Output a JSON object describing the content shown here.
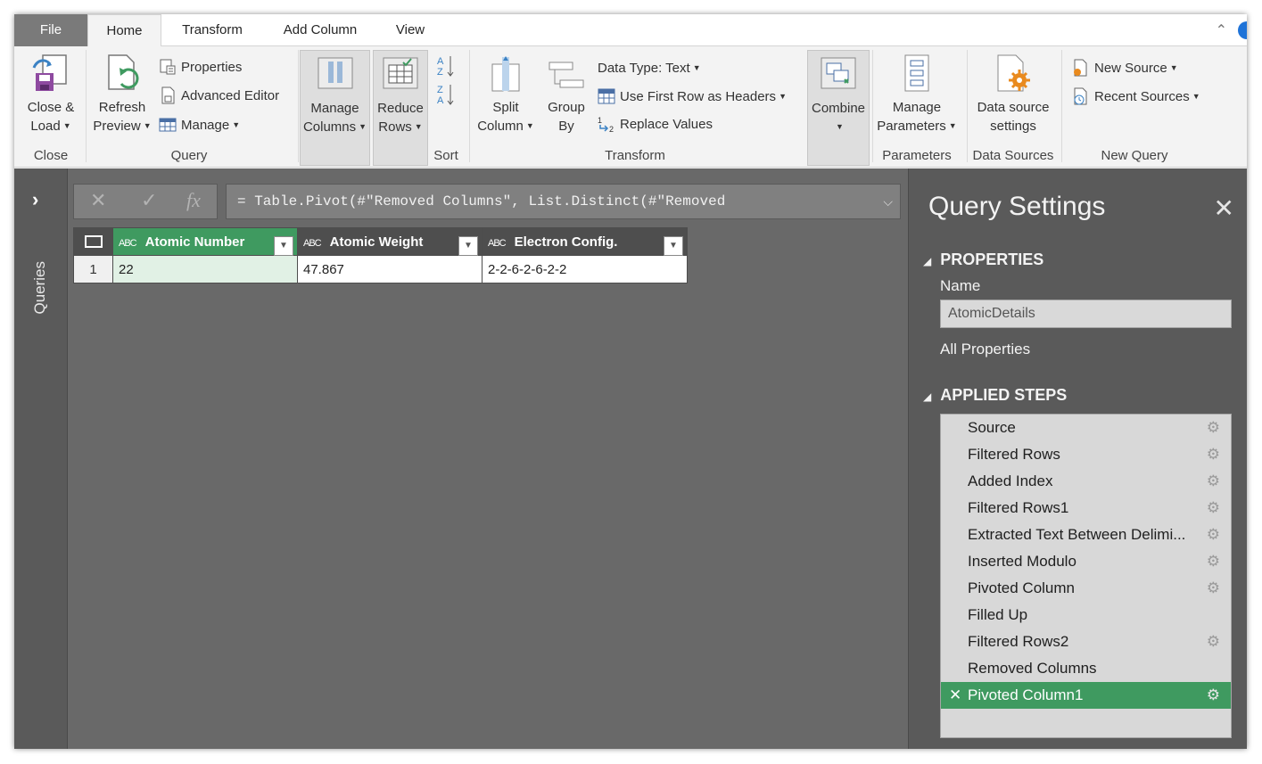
{
  "tabs": [
    "File",
    "Home",
    "Transform",
    "Add Column",
    "View"
  ],
  "ribbon": {
    "close": {
      "button": "Close &",
      "button2": "Load",
      "label": "Close"
    },
    "query": {
      "refresh": "Refresh",
      "refresh2": "Preview",
      "properties": "Properties",
      "advanced_editor": "Advanced Editor",
      "manage": "Manage",
      "label": "Query"
    },
    "manage_columns": {
      "line1": "Manage",
      "line2": "Columns"
    },
    "reduce_rows": {
      "line1": "Reduce",
      "line2": "Rows"
    },
    "sort": {
      "label": "Sort"
    },
    "transform": {
      "split": "Split",
      "split2": "Column",
      "group": "Group",
      "group2": "By",
      "data_type": "Data Type: Text",
      "first_row": "Use First Row as Headers",
      "replace": "Replace Values",
      "label": "Transform"
    },
    "combine": {
      "line1": "Combine"
    },
    "parameters": {
      "line1": "Manage",
      "line2": "Parameters",
      "label": "Parameters"
    },
    "data_sources": {
      "line1": "Data source",
      "line2": "settings",
      "label": "Data Sources"
    },
    "new_query": {
      "new_source": "New Source",
      "recent_sources": "Recent Sources",
      "label": "New Query"
    }
  },
  "queries_pane": {
    "label": "Queries"
  },
  "formula_bar": {
    "text": "= Table.Pivot(#\"Removed Columns\", List.Distinct(#\"Removed"
  },
  "grid": {
    "type_prefix": "ABC",
    "columns": [
      "Atomic Number",
      "Atomic Weight",
      "Electron Config."
    ],
    "rows": [
      {
        "num": "1",
        "cells": [
          "22",
          "47.867",
          "2-2-6-2-6-2-2"
        ]
      }
    ]
  },
  "settings": {
    "title": "Query Settings",
    "properties_head": "PROPERTIES",
    "name_label": "Name",
    "name_value": "AtomicDetails",
    "all_properties": "All Properties",
    "steps_head": "APPLIED STEPS",
    "steps": [
      {
        "name": "Source",
        "gear": true
      },
      {
        "name": "Filtered Rows",
        "gear": true
      },
      {
        "name": "Added Index",
        "gear": true
      },
      {
        "name": "Filtered Rows1",
        "gear": true
      },
      {
        "name": "Extracted Text Between Delimi...",
        "gear": true
      },
      {
        "name": "Inserted Modulo",
        "gear": true
      },
      {
        "name": "Pivoted Column",
        "gear": true
      },
      {
        "name": "Filled Up",
        "gear": false
      },
      {
        "name": "Filtered Rows2",
        "gear": true
      },
      {
        "name": "Removed Columns",
        "gear": false
      },
      {
        "name": "Pivoted Column1",
        "gear": true,
        "active": true
      }
    ]
  },
  "colors": {
    "accent_green": "#3f9a60",
    "workspace": "#696969",
    "panel": "#5a5a5a"
  }
}
